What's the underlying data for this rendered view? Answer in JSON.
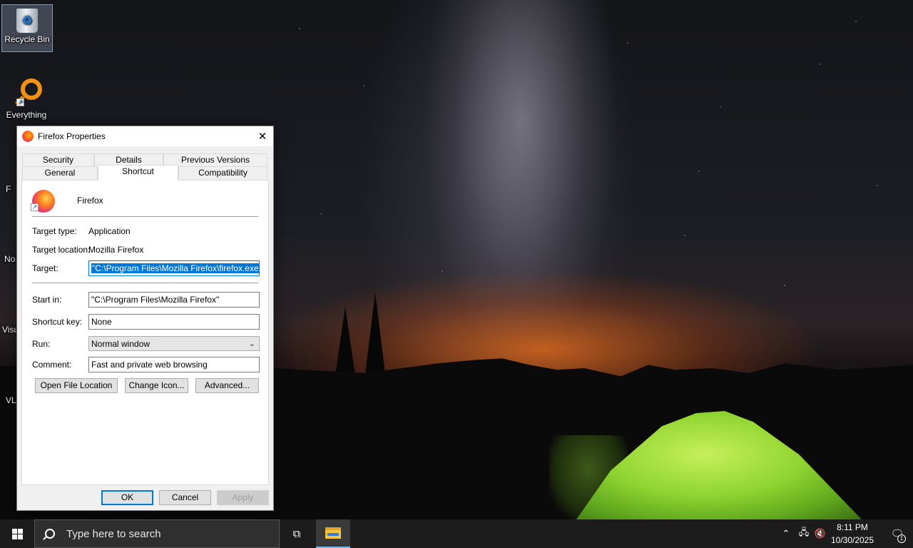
{
  "desktop": {
    "icons": [
      {
        "label": "Recycle Bin"
      },
      {
        "label": "Everything"
      }
    ],
    "partial_labels": [
      "F",
      "No",
      "Visu",
      "VL"
    ]
  },
  "dialog": {
    "title": "Firefox Properties",
    "close_glyph": "✕",
    "tabs_row1": [
      "Security",
      "Details",
      "Previous Versions"
    ],
    "tabs_row2": [
      "General",
      "Shortcut",
      "Compatibility"
    ],
    "active_tab": "Shortcut",
    "app_name": "Firefox",
    "target_type": {
      "label": "Target type:",
      "value": "Application"
    },
    "target_location": {
      "label": "Target location:",
      "value": "Mozilla Firefox"
    },
    "target": {
      "label": "Target:",
      "value": "\"C:\\Program Files\\Mozilla Firefox\\firefox.exe\""
    },
    "start_in": {
      "label": "Start in:",
      "value": "\"C:\\Program Files\\Mozilla Firefox\""
    },
    "shortcut_key": {
      "label": "Shortcut key:",
      "value": "None"
    },
    "run": {
      "label": "Run:",
      "value": "Normal window"
    },
    "comment": {
      "label": "Comment:",
      "value": "Fast and private web browsing"
    },
    "buttons": {
      "open_file_location": "Open File Location",
      "change_icon": "Change Icon...",
      "advanced": "Advanced..."
    },
    "footer": {
      "ok": "OK",
      "cancel": "Cancel",
      "apply": "Apply"
    }
  },
  "taskbar": {
    "search_placeholder": "Type here to search",
    "time": "8:11 PM",
    "date": "10/30/2025",
    "notification_count": "1"
  },
  "colors": {
    "accent": "#0078d7",
    "taskbar": "#1c1c1c",
    "tent_green": "#8fd430"
  }
}
